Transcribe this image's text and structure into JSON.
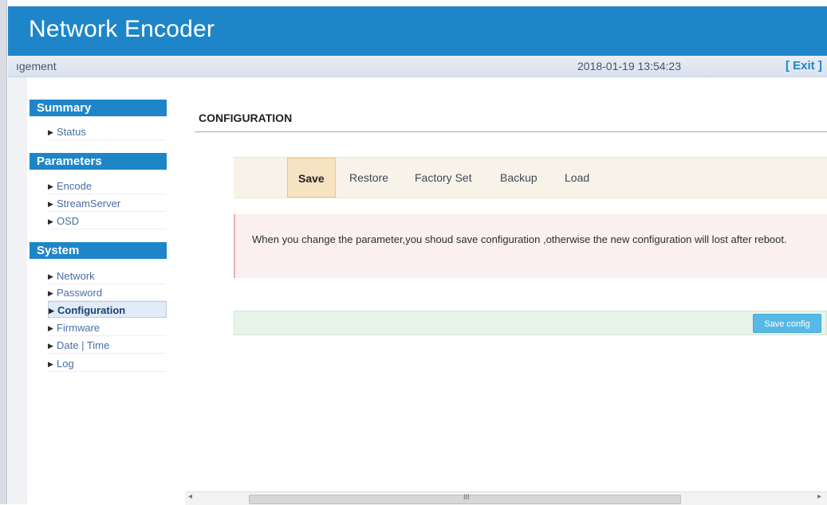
{
  "header": {
    "title": "Network Encoder"
  },
  "statusbar": {
    "management": "ıgement",
    "datetime": "2018-01-19 13:54:23",
    "exit": "[ Exit ]"
  },
  "sidebar": {
    "sections": [
      {
        "title": "Summary",
        "items": [
          "Status"
        ]
      },
      {
        "title": "Parameters",
        "items": [
          "Encode",
          "StreamServer",
          "OSD"
        ]
      },
      {
        "title": "System",
        "items": [
          "Network",
          "Password",
          "Configuration",
          "Firmware",
          "Date | Time",
          "Log"
        ]
      }
    ],
    "active_item": "Configuration"
  },
  "main": {
    "page_title": "CONFIGURATION",
    "tabs": [
      "Save",
      "Restore",
      "Factory Set",
      "Backup",
      "Load"
    ],
    "active_tab": "Save",
    "notice": "When you change the parameter,you shoud save configuration ,otherwise the new configuration will lost after reboot.",
    "save_button": "Save config"
  },
  "scrollbar": {
    "grip": "III"
  },
  "colors": {
    "accent": "#1e86c8",
    "notice_bg": "#fbf0ef",
    "savebar_bg": "#e8f3ea",
    "button": "#58b9e6"
  }
}
